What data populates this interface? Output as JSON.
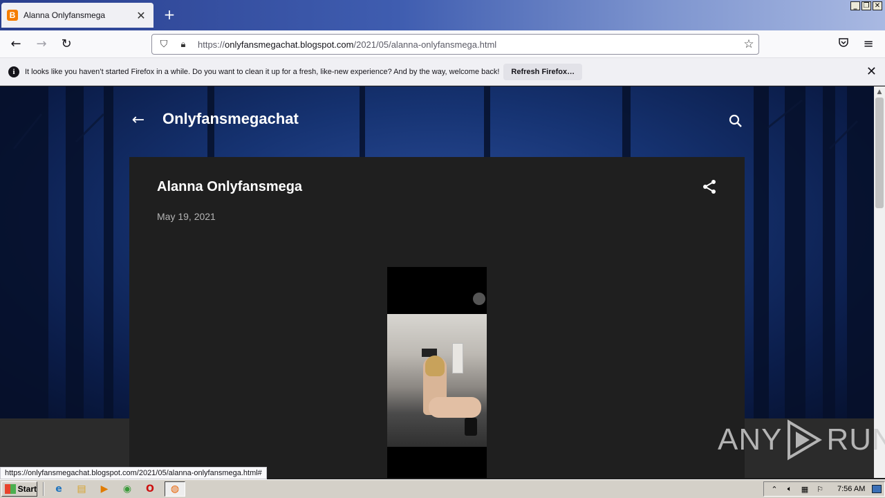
{
  "browser": {
    "tab_title": "Alanna Onlyfansmega",
    "tab_favicon": "B",
    "new_tab": "+",
    "url_scheme": "https://",
    "url_host": "onlyfansmegachat.blogspot.com",
    "url_path": "/2021/05/alanna-onlyfansmega.html",
    "notification_text": "It looks like you haven’t started Firefox in a while. Do you want to clean it up for a fresh, like-new experience? And by the way, welcome back!",
    "notification_button": "Refresh Firefox…",
    "status_url": "https://onlyfansmegachat.blogspot.com/2021/05/alanna-onlyfansmega.html#"
  },
  "page": {
    "blog_title": "Onlyfansmegachat",
    "post_title": "Alanna Onlyfansmega",
    "post_date": "May 19, 2021"
  },
  "watermark": {
    "left": "ANY",
    "right": "RUN"
  },
  "taskbar": {
    "start_label": "Start",
    "clock": "7:56 AM"
  },
  "colors": {
    "accent_blog_bg": "#1f1f1f",
    "forest_blue": "#163372",
    "firefox_chrome": "#f9f9fb"
  }
}
